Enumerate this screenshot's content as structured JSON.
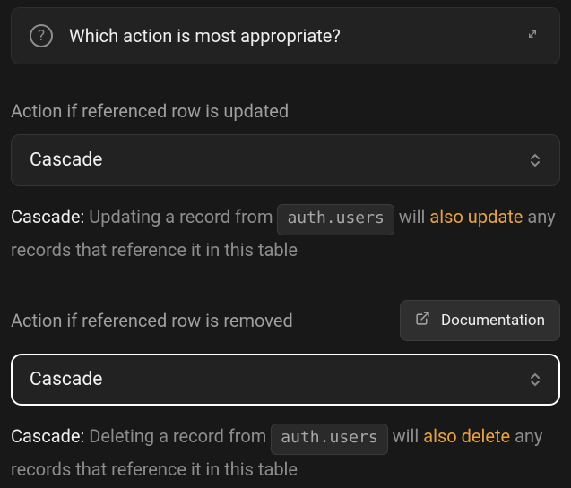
{
  "info": {
    "question": "Which action is most appropriate?"
  },
  "update": {
    "label": "Action if referenced row is updated",
    "selected": "Cascade",
    "desc_bold": "Cascade:",
    "desc_pre": " Updating a record from ",
    "desc_code": "auth.users",
    "desc_mid": " will ",
    "desc_hi": "also update",
    "desc_post": " any records that reference it in this table"
  },
  "remove": {
    "label": "Action if referenced row is removed",
    "doc_label": "Documentation",
    "selected": "Cascade",
    "desc_bold": "Cascade:",
    "desc_pre": " Deleting a record from ",
    "desc_code": "auth.users",
    "desc_mid": " will ",
    "desc_hi": "also delete",
    "desc_post": " any records that reference it in this table"
  }
}
